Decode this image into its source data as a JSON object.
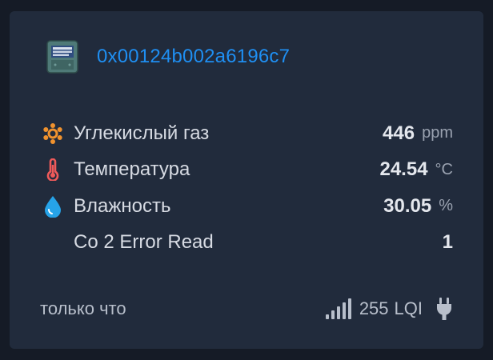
{
  "device": {
    "address": "0x00124b002a6196c7"
  },
  "rows": [
    {
      "icon": "molecule-icon",
      "label": "Углекислый газ",
      "value": "446",
      "unit": "ppm"
    },
    {
      "icon": "thermometer-icon",
      "label": "Температура",
      "value": "24.54",
      "unit": "°C"
    },
    {
      "icon": "water-drop-icon",
      "label": "Влажность",
      "value": "30.05",
      "unit": "%"
    },
    {
      "icon": "",
      "label": "Co 2 Error Read",
      "value": "1",
      "unit": ""
    }
  ],
  "footer": {
    "last_seen": "только что",
    "lqi_value": "255",
    "lqi_unit": "LQI",
    "signal_icon": "signal-strength-icon",
    "power_icon": "power-plug-icon"
  },
  "colors": {
    "background": "#151b26",
    "card": "#212b3c",
    "link": "#1f8ff2",
    "co2_icon": "#f0922e",
    "temperature_icon": "#ef5a5a",
    "humidity_icon": "#26a3e8"
  }
}
